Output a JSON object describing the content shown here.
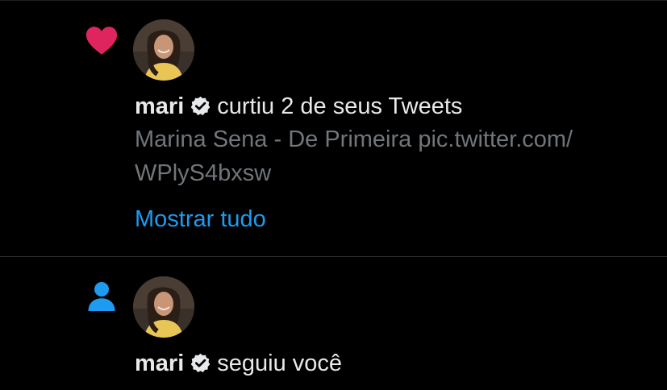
{
  "notifications": [
    {
      "type_icon": "heart-icon",
      "user": "mari",
      "verified": true,
      "action": "curtiu 2 de seus Tweets",
      "preview_line_1": "Marina Sena - De Primeira pic.twitter.com/",
      "preview_line_2": "WPlyS4bxsw",
      "show_all": "Mostrar tudo"
    },
    {
      "type_icon": "person-icon",
      "user": "mari",
      "verified": true,
      "action": "seguiu você"
    }
  ],
  "colors": {
    "background": "#000000",
    "heart": "#e0245e",
    "follow_icon": "#1d9bf0",
    "link": "#1d9bf0",
    "muted_text": "#71767b",
    "primary_text": "#e7e9ea",
    "divider": "#2f3336"
  }
}
